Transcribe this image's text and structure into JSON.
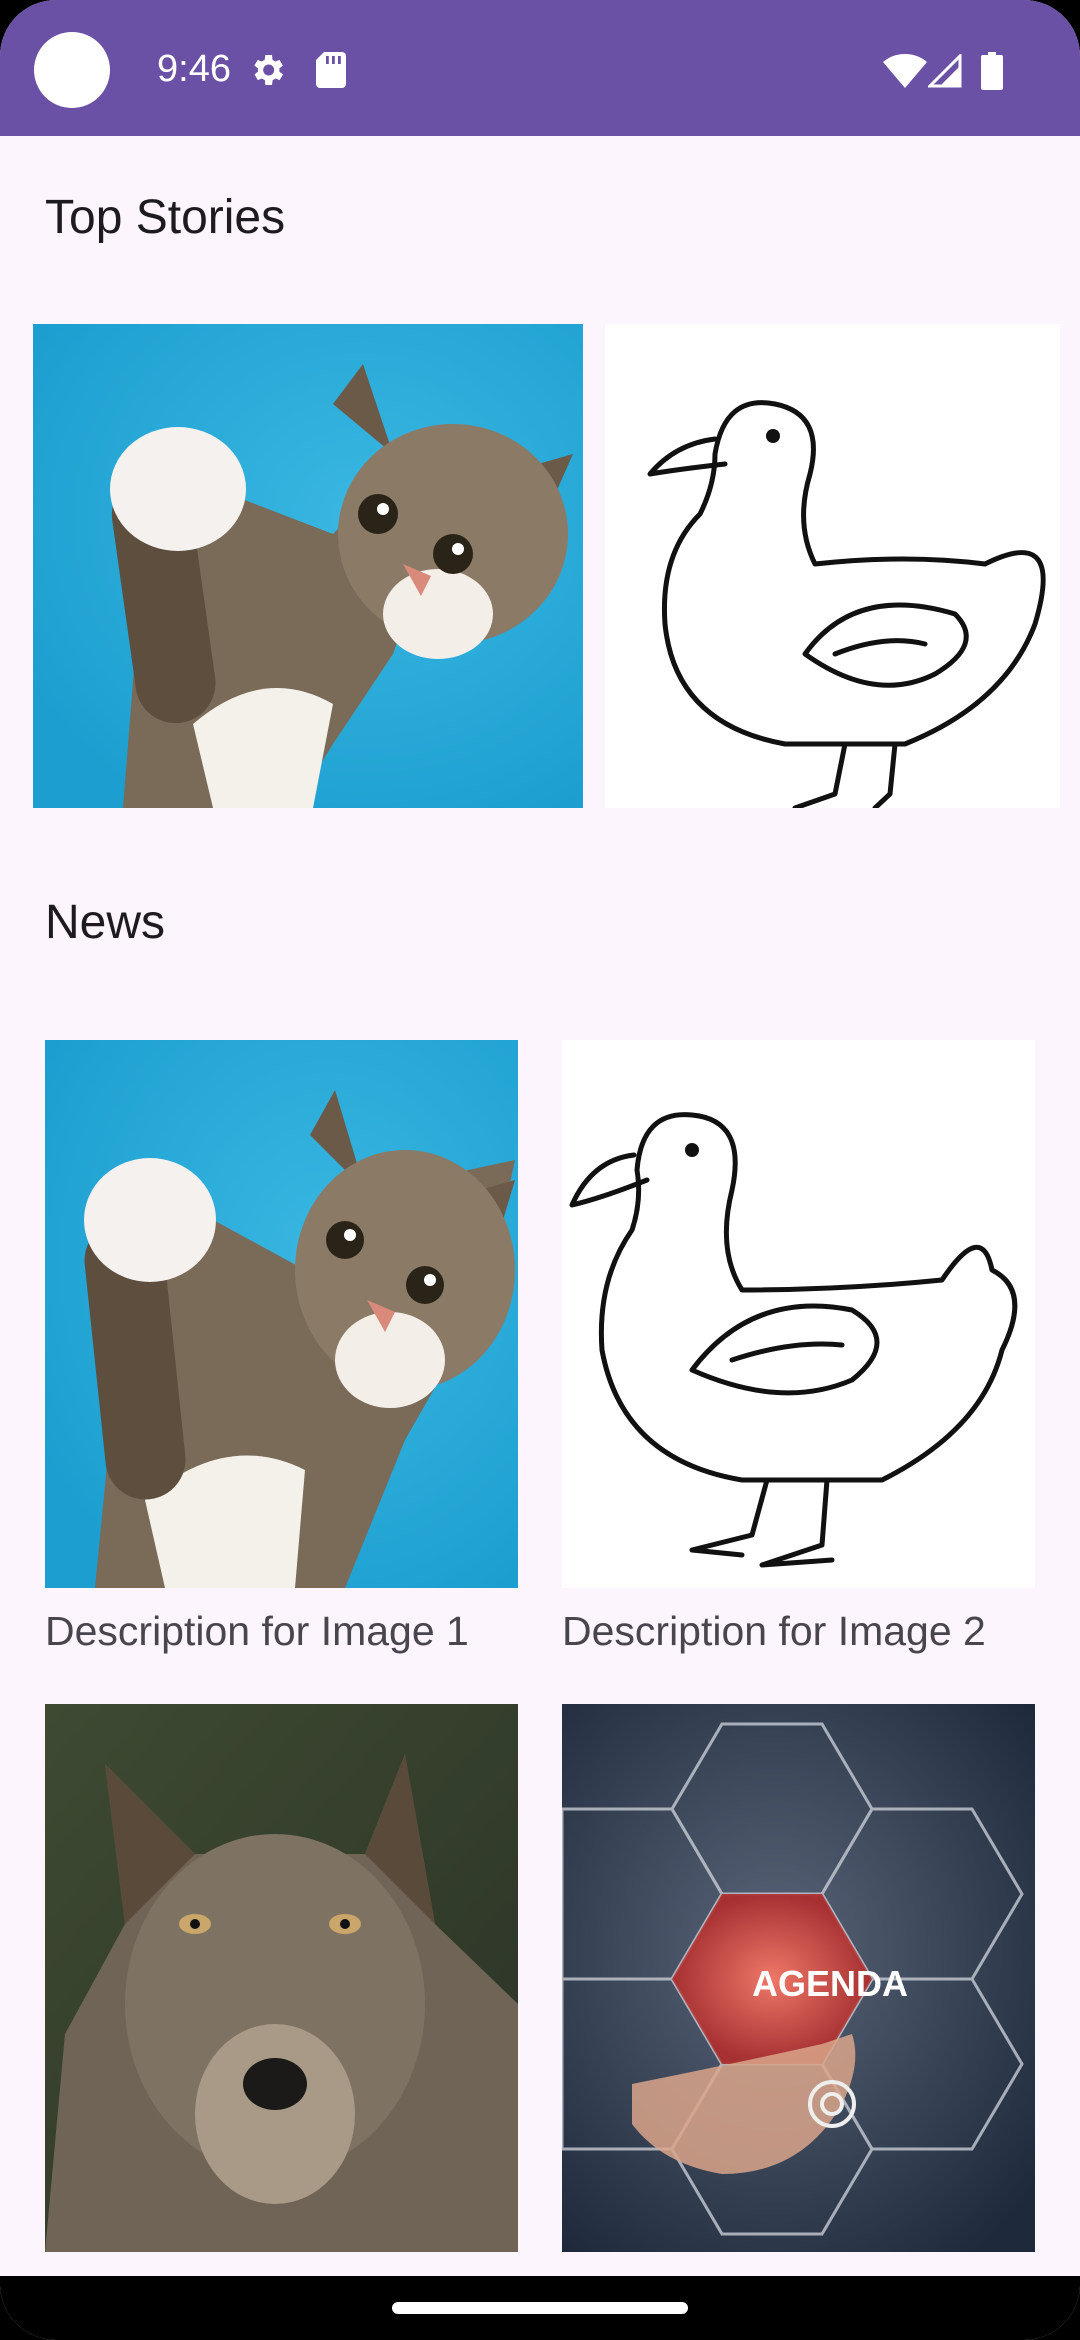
{
  "status_bar": {
    "time": "9:46",
    "icons": [
      "settings-gear-icon",
      "sd-card-icon",
      "wifi-icon",
      "cell-signal-icon",
      "battery-icon"
    ],
    "background": "#6a51a6"
  },
  "sections": {
    "top_stories": {
      "title": "Top Stories",
      "items": [
        {
          "image": "cat-photo"
        },
        {
          "image": "duck-drawing"
        }
      ]
    },
    "news": {
      "title": "News",
      "items": [
        {
          "image": "cat-photo",
          "caption": "Description for Image 1"
        },
        {
          "image": "duck-drawing",
          "caption": "Description for Image 2"
        },
        {
          "image": "wolf-photo",
          "caption": ""
        },
        {
          "image": "agenda-graphic",
          "overlay_text": "AGENDA",
          "caption": ""
        }
      ]
    }
  },
  "colors": {
    "background": "#fdf5fd",
    "title_text": "#1d1b20",
    "caption_text": "#49454f"
  }
}
